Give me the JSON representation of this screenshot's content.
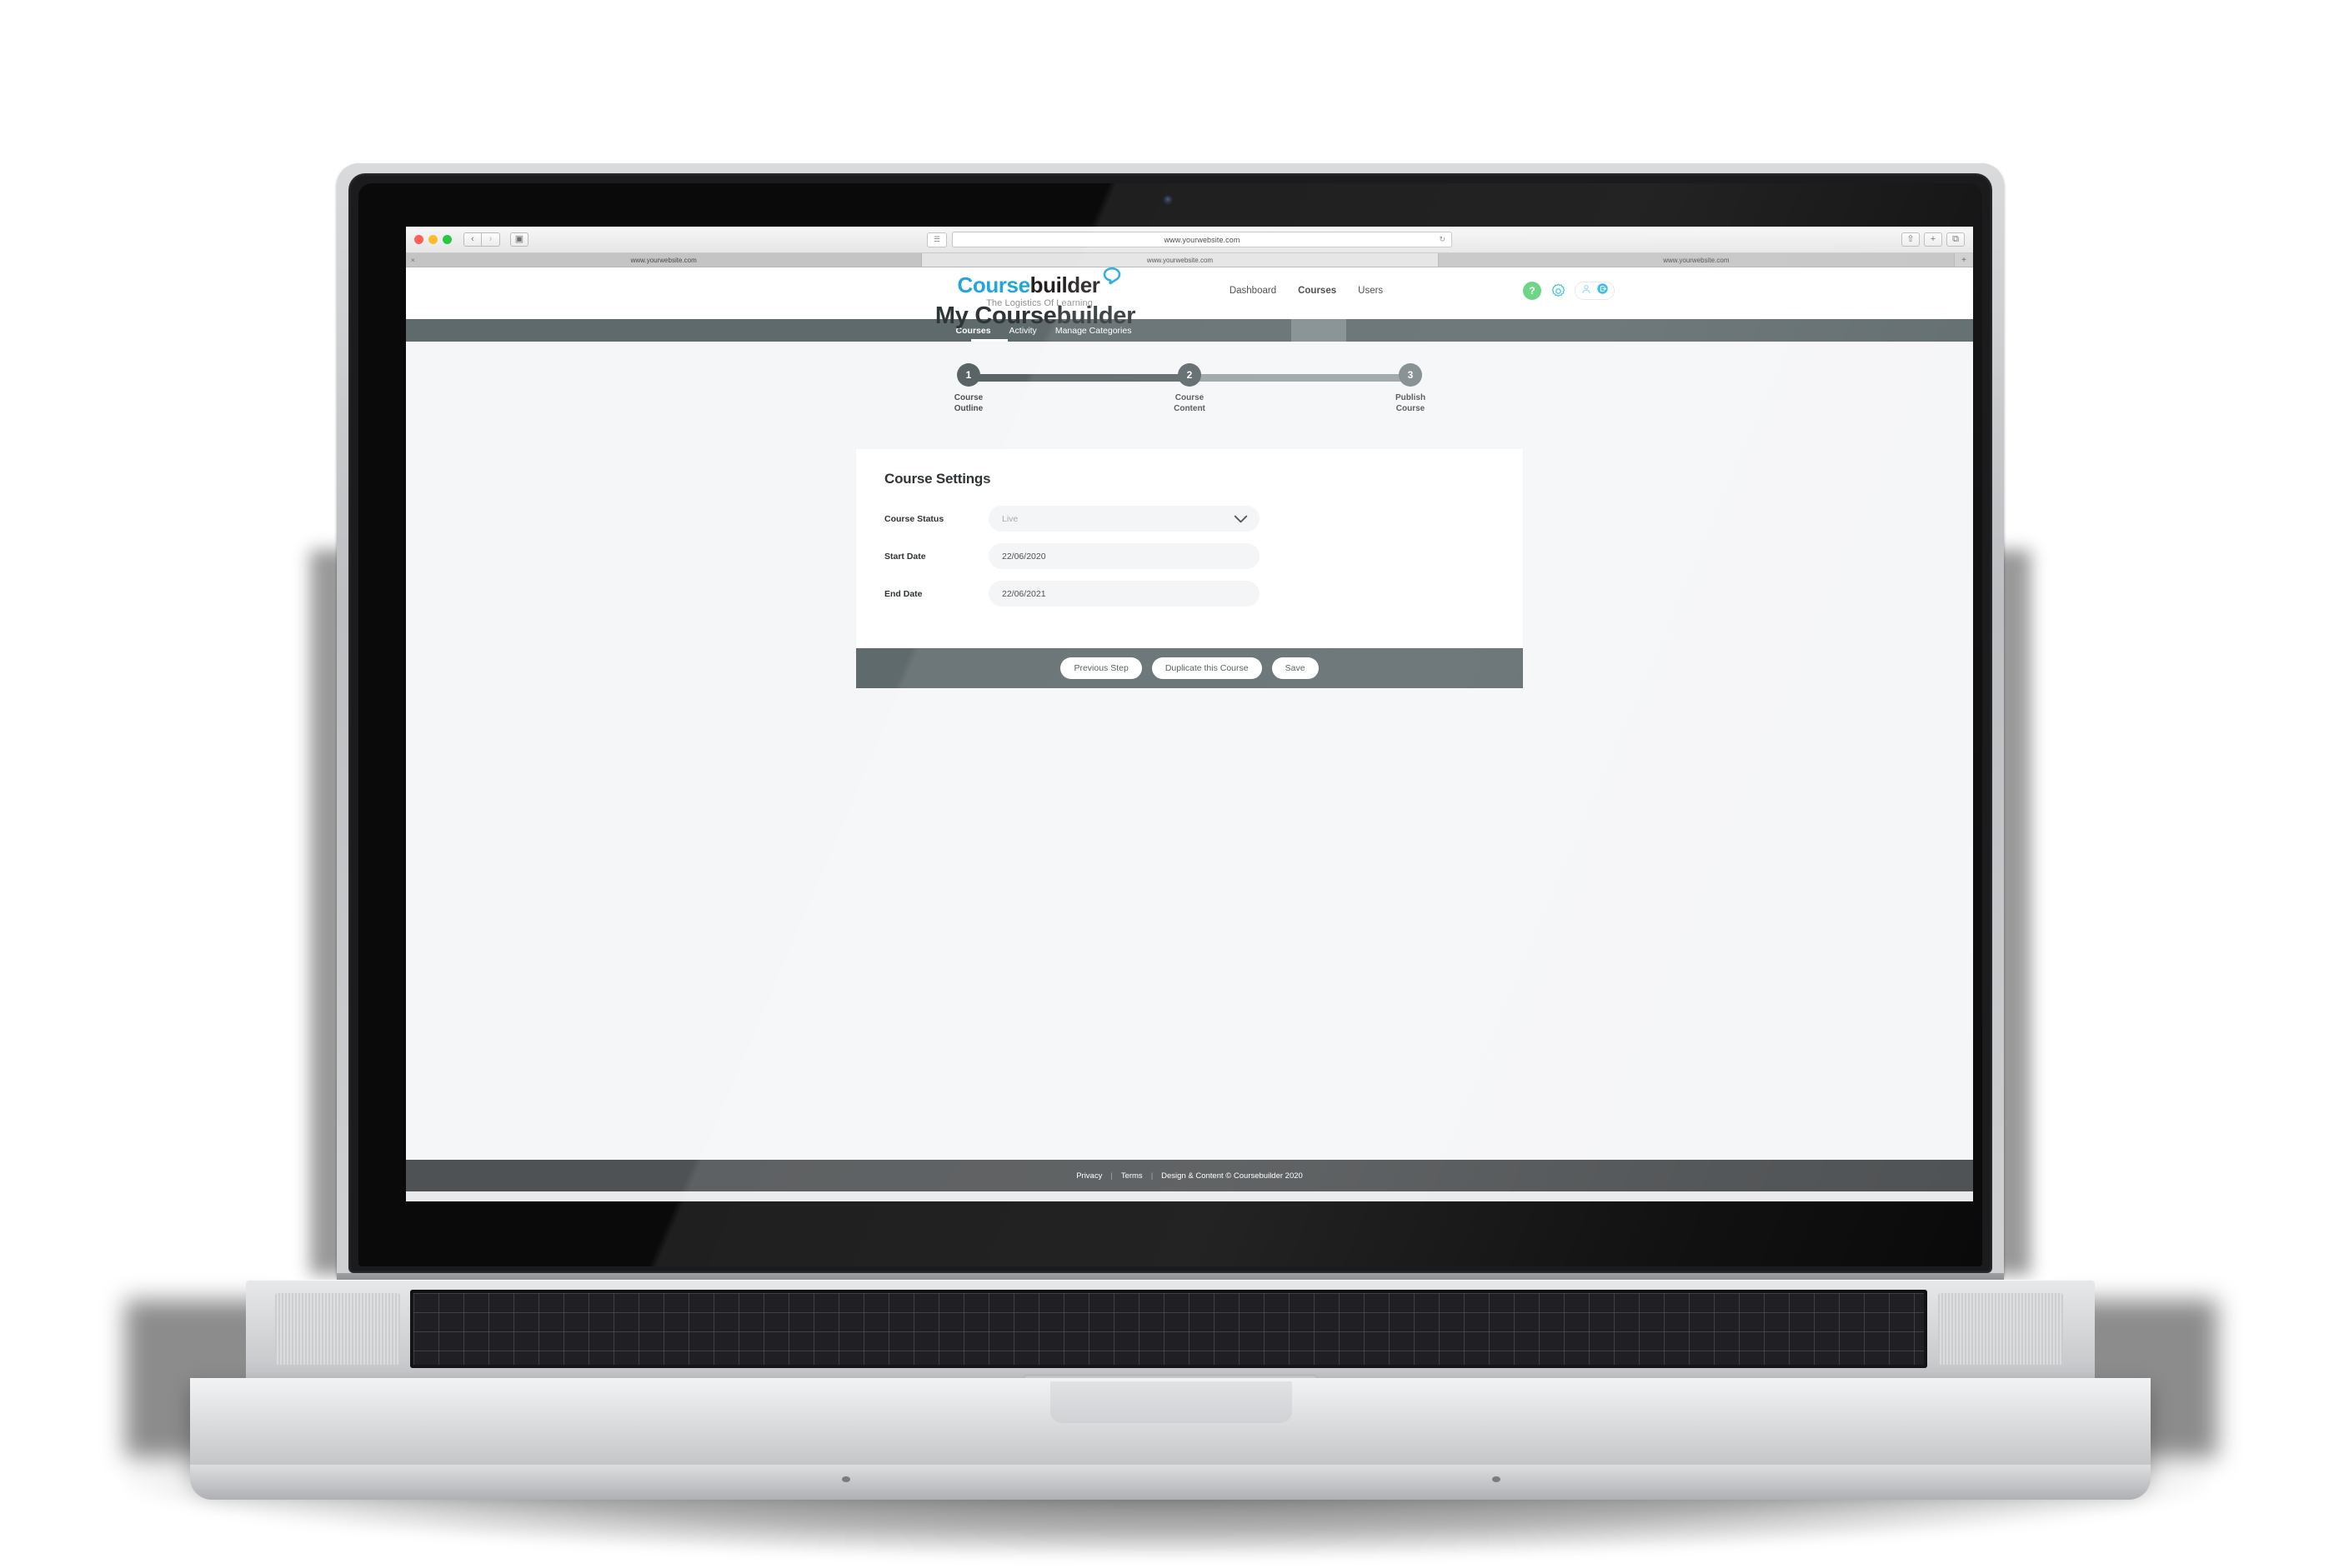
{
  "browser": {
    "address": "www.yourwebsite.com",
    "reload_icon": "reload-icon",
    "reader_icon": "reader-view-icon",
    "back_icon": "‹",
    "forward_icon": "›",
    "sidebar_icon": "▣",
    "share_icon": "⇧",
    "tabs_icon": "⧉",
    "newtab_icon": "+",
    "tabs": [
      {
        "title": "www.yourwebsite.com",
        "active": false,
        "close": "×"
      },
      {
        "title": "www.yourwebsite.com",
        "active": true,
        "close": ""
      },
      {
        "title": "www.yourwebsite.com",
        "active": false,
        "close": ""
      }
    ]
  },
  "brand": {
    "name_part1": "Course",
    "name_part2": "builder",
    "tagline": "The Logistics Of Learning",
    "color_primary": "#22a7d8",
    "color_dark": "#231f20"
  },
  "header": {
    "nav": [
      {
        "label": "Dashboard",
        "active": false
      },
      {
        "label": "Courses",
        "active": true
      },
      {
        "label": "Users",
        "active": false
      }
    ],
    "icons": {
      "help": "?",
      "help_color": "#5ed07a",
      "gear": "gear-icon",
      "user": "user-icon",
      "logout": "logout-icon"
    }
  },
  "subnav": {
    "items": [
      {
        "label": "Courses",
        "active": true
      },
      {
        "label": "Activity",
        "active": false
      },
      {
        "label": "Manage Categories",
        "active": false
      }
    ],
    "bar_color": "#5f6a6d"
  },
  "page": {
    "title": "My Coursebuilder"
  },
  "stepper": {
    "steps": [
      {
        "number": "1",
        "line1": "Course",
        "line2": "Outline",
        "state": "done"
      },
      {
        "number": "2",
        "line1": "Course",
        "line2": "Content",
        "state": "done"
      },
      {
        "number": "3",
        "line1": "Publish",
        "line2": "Course",
        "state": "todo"
      }
    ],
    "done_color": "#5a6466",
    "todo_color": "#9aa2a4"
  },
  "card": {
    "heading": "Course Settings",
    "fields": [
      {
        "label": "Course Status",
        "value": "Live",
        "type": "select",
        "placeholder_style": true
      },
      {
        "label": "Start Date",
        "value": "22/06/2020",
        "type": "date",
        "placeholder_style": false
      },
      {
        "label": "End Date",
        "value": "22/06/2021",
        "type": "date",
        "placeholder_style": false
      }
    ],
    "buttons": [
      {
        "label": "Previous Step"
      },
      {
        "label": "Duplicate this Course"
      },
      {
        "label": "Save"
      }
    ]
  },
  "footer": {
    "privacy": "Privacy",
    "terms": "Terms",
    "separator": "|",
    "copyright": "Design & Content © Coursebuilder 2020"
  }
}
